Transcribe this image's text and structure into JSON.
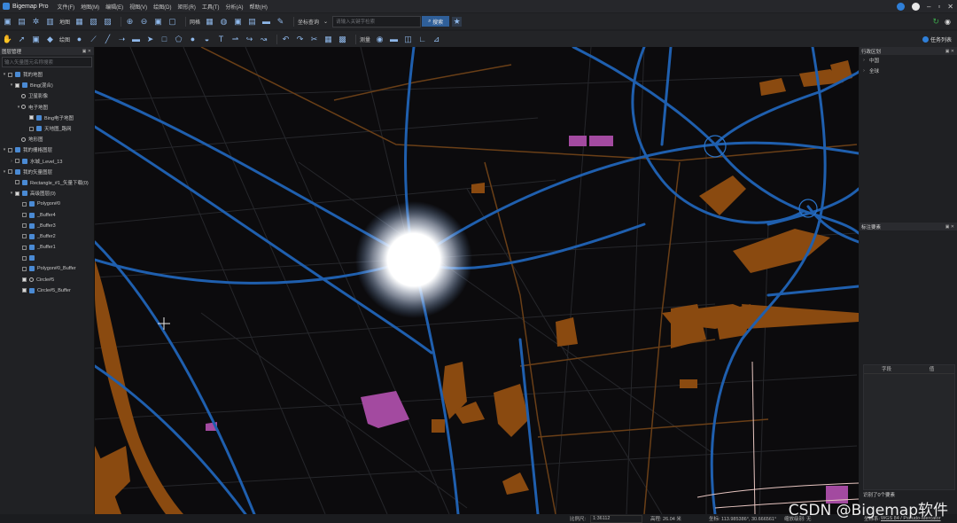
{
  "app": {
    "title": "Bigemap Pro"
  },
  "menu": [
    "文件(F)",
    "地图(M)",
    "编辑(E)",
    "视图(V)",
    "绘图(D)",
    "矩形(R)",
    "工具(T)",
    "分析(A)",
    "帮助(H)"
  ],
  "toolbar1": {
    "map_label": "地图",
    "grid_label": "网格",
    "search_dropdown": "坐标查询",
    "search_placeholder": "请输入关键字检索",
    "search_button": "搜索"
  },
  "toolbar2": {
    "draw_label": "绘图",
    "measure_label": "测量",
    "task_list": "任务列表"
  },
  "layers_panel": {
    "title": "图层管理",
    "filter_placeholder": "输入矢量图元名称搜索",
    "items": [
      {
        "label": "我的地图"
      },
      {
        "label": "Bing(混合)"
      },
      {
        "label": "卫星影像"
      },
      {
        "label": "电子地图"
      },
      {
        "label": "Bing电子地图"
      },
      {
        "label": "天地图_路网"
      },
      {
        "label": "地形图"
      },
      {
        "label": "我的栅格图层"
      },
      {
        "label": "水城_Level_13"
      },
      {
        "label": "我的矢量图层"
      },
      {
        "label": "Rectangle_#1_矢量下载(0)"
      },
      {
        "label": "高级图层(0)"
      },
      {
        "label": "Polygon#0"
      },
      {
        "label": "_Buffer4"
      },
      {
        "label": "_Buffer3"
      },
      {
        "label": "_Buffer2"
      },
      {
        "label": "_Buffer1"
      },
      {
        "label": ""
      },
      {
        "label": "Polygon#0_Buffer"
      },
      {
        "label": "Circle#5"
      },
      {
        "label": "Circle#5_Buffer"
      }
    ]
  },
  "admin_panel": {
    "title": "行政区划",
    "items": [
      "中国",
      "全球"
    ]
  },
  "attr_panel": {
    "title": "标注要素",
    "col_field": "字段",
    "col_value": "值",
    "footer": "识别了0个要素"
  },
  "status": {
    "scale_label": "比例尺:",
    "scale_value": "1:36112",
    "elevation": "高程: 26.04 米",
    "coords": "坐标: 113.985386°, 30.666561°",
    "projection_label": "坐标系:",
    "projection": "WGS 84 / Pseudo-Mercator",
    "zoom": "缩放级别: 无"
  },
  "watermark": "CSDN @Bigemap软件",
  "colors": {
    "road": "#1f5fae",
    "water": "#8a4a10",
    "highlight": "#a34aa0"
  }
}
